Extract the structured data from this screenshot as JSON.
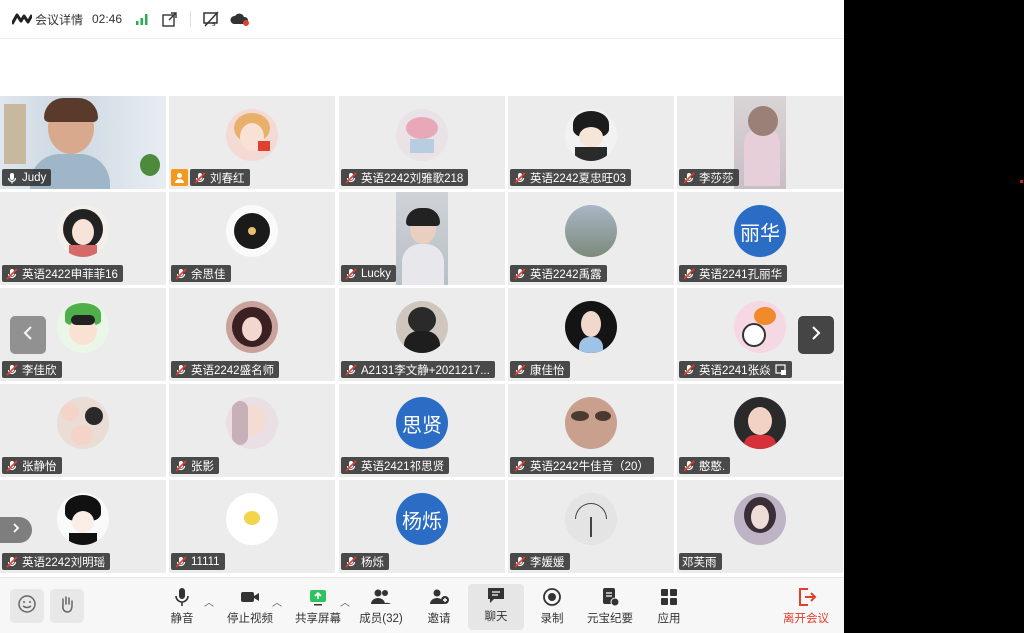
{
  "topbar": {
    "meeting_details": "会议详情",
    "timer": "02:46"
  },
  "participants": [
    {
      "name": "Judy"
    },
    {
      "name": "刘春红"
    },
    {
      "name": "英语2242刘雅歌218"
    },
    {
      "name": "英语2242夏忠旺03"
    },
    {
      "name": "李莎莎"
    },
    {
      "name": "英语2422申菲菲16"
    },
    {
      "name": "余思佳"
    },
    {
      "name": "Lucky"
    },
    {
      "name": "英语2242禹露"
    },
    {
      "name": "英语2241孔丽华",
      "avatar_text": "丽华"
    },
    {
      "name": "李佳欣"
    },
    {
      "name": "英语2242盛名师"
    },
    {
      "name": "A2131李文静+2021217..."
    },
    {
      "name": "康佳怡"
    },
    {
      "name": "英语2241张焱"
    },
    {
      "name": "张静怡"
    },
    {
      "name": "张影"
    },
    {
      "name": "英语2421祁思贤",
      "avatar_text": "思贤"
    },
    {
      "name": "英语2242牛佳音（20）"
    },
    {
      "name": "憨憨."
    },
    {
      "name": "英语2242刘明瑶"
    },
    {
      "name": "11111"
    },
    {
      "name": "杨烁",
      "avatar_text": "杨烁"
    },
    {
      "name": "李媛媛"
    },
    {
      "name": "邓芙雨"
    }
  ],
  "toolbar": {
    "mute": "静音",
    "stop_video": "停止视频",
    "share_screen": "共享屏幕",
    "members": "成员(32)",
    "invite": "邀请",
    "chat": "聊天",
    "record": "录制",
    "yuanbao": "元宝纪要",
    "apps": "应用",
    "leave": "离开会议"
  },
  "colors": {
    "active_speaker": "#2fc35f",
    "leave": "#e0412f",
    "signal": "#22b14c",
    "avatar_blue": "#2b6cc4"
  }
}
